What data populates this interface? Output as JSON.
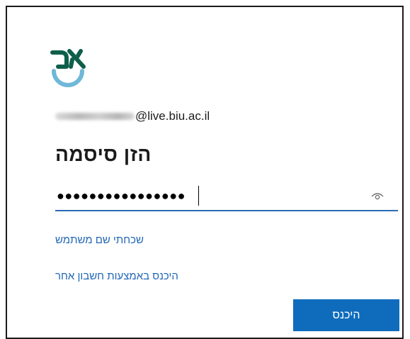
{
  "logo": {
    "icon": "biu-logo-icon",
    "colors": {
      "dark": "#0e5f4b",
      "light": "#6fb8d8"
    }
  },
  "account": {
    "email_visible_suffix": "@live.biu.ac.il"
  },
  "title": "הזן סיסמה",
  "password": {
    "masked_value": "●●●●●●●●●●●●●●●●",
    "reveal_icon": "eye-icon"
  },
  "links": {
    "forgot_username": "שכחתי שם משתמש",
    "other_account": "היכנס באמצעות חשבון אחר"
  },
  "submit_label": "היכנס",
  "colors": {
    "accent": "#0f6cbd",
    "link": "#2367b5",
    "text": "#1b1b1b"
  }
}
